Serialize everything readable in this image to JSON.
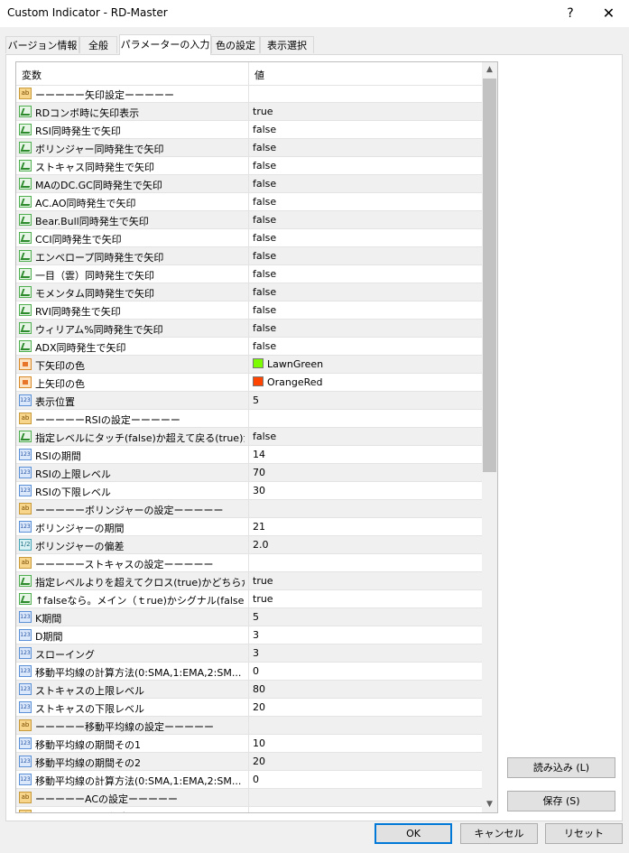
{
  "window": {
    "title": "Custom Indicator - RD-Master",
    "help": "?",
    "close": "✕"
  },
  "tabs": [
    "バージョン情報",
    "全般",
    "パラメーターの入力",
    "色の設定",
    "表示選択"
  ],
  "grid": {
    "header_name": "変数",
    "header_value": "値",
    "rows": [
      {
        "type": "ab",
        "name": "ーーーーー矢印設定ーーーーー",
        "value": ""
      },
      {
        "type": "bool",
        "name": "RDコンボ時に矢印表示",
        "value": "true"
      },
      {
        "type": "bool",
        "name": "RSI同時発生で矢印",
        "value": "false"
      },
      {
        "type": "bool",
        "name": "ボリンジャー同時発生で矢印",
        "value": "false"
      },
      {
        "type": "bool",
        "name": "ストキャス同時発生で矢印",
        "value": "false"
      },
      {
        "type": "bool",
        "name": "MAのDC.GC同時発生で矢印",
        "value": "false"
      },
      {
        "type": "bool",
        "name": "AC.AO同時発生で矢印",
        "value": "false"
      },
      {
        "type": "bool",
        "name": "Bear.Bull同時発生で矢印",
        "value": "false"
      },
      {
        "type": "bool",
        "name": "CCI同時発生で矢印",
        "value": "false"
      },
      {
        "type": "bool",
        "name": "エンベロープ同時発生で矢印",
        "value": "false"
      },
      {
        "type": "bool",
        "name": "一目（雲）同時発生で矢印",
        "value": "false"
      },
      {
        "type": "bool",
        "name": "モメンタム同時発生で矢印",
        "value": "false"
      },
      {
        "type": "bool",
        "name": "RVI同時発生で矢印",
        "value": "false"
      },
      {
        "type": "bool",
        "name": "ウィリアム%同時発生で矢印",
        "value": "false"
      },
      {
        "type": "bool",
        "name": "ADX同時発生で矢印",
        "value": "false"
      },
      {
        "type": "color",
        "name": "下矢印の色",
        "value": "LawnGreen",
        "swatch": "#7cfc00"
      },
      {
        "type": "color",
        "name": "上矢印の色",
        "value": "OrangeRed",
        "swatch": "#ff4500"
      },
      {
        "type": "int",
        "name": "表示位置",
        "value": "5"
      },
      {
        "type": "ab",
        "name": "ーーーーーRSIの設定ーーーーー",
        "value": ""
      },
      {
        "type": "bool",
        "name": "指定レベルにタッチ(false)か超えて戻る(true)か",
        "value": "false"
      },
      {
        "type": "int",
        "name": "RSIの期間",
        "value": "14"
      },
      {
        "type": "int",
        "name": "RSIの上限レベル",
        "value": "70"
      },
      {
        "type": "int",
        "name": "RSIの下限レベル",
        "value": "30"
      },
      {
        "type": "ab",
        "name": "ーーーーーボリンジャーの設定ーーーーー",
        "value": ""
      },
      {
        "type": "int",
        "name": "ボリンジャーの期間",
        "value": "21"
      },
      {
        "type": "dbl",
        "name": "ボリンジャーの偏差",
        "value": "2.0"
      },
      {
        "type": "ab",
        "name": "ーーーーーストキャスの設定ーーーーー",
        "value": ""
      },
      {
        "type": "bool",
        "name": "指定レベルよりを超えてクロス(true)かどちらかの...",
        "value": "true"
      },
      {
        "type": "bool",
        "name": "↑falseなら。メイン（ｔrue)かシグナル(false)か",
        "value": "true"
      },
      {
        "type": "int",
        "name": "K期間",
        "value": "5"
      },
      {
        "type": "int",
        "name": "D期間",
        "value": "3"
      },
      {
        "type": "int",
        "name": "スローイング",
        "value": "3"
      },
      {
        "type": "int",
        "name": "移動平均線の計算方法(0:SMA,1:EMA,2:SM...",
        "value": "0"
      },
      {
        "type": "int",
        "name": "ストキャスの上限レベル",
        "value": "80"
      },
      {
        "type": "int",
        "name": "ストキャスの下限レベル",
        "value": "20"
      },
      {
        "type": "ab",
        "name": "ーーーーー移動平均線の設定ーーーーー",
        "value": ""
      },
      {
        "type": "int",
        "name": "移動平均線の期間その1",
        "value": "10"
      },
      {
        "type": "int",
        "name": "移動平均線の期間その2",
        "value": "20"
      },
      {
        "type": "int",
        "name": "移動平均線の計算方法(0:SMA,1:EMA,2:SM...",
        "value": "0"
      },
      {
        "type": "ab",
        "name": "ーーーーーACの設定ーーーーー",
        "value": ""
      },
      {
        "type": "ab",
        "name": "ーーーーーAOの設定ーーーーー",
        "value": ""
      }
    ]
  },
  "side_buttons": {
    "load": "読み込み (L)",
    "save": "保存 (S)"
  },
  "footer_buttons": {
    "ok": "OK",
    "cancel": "キャンセル",
    "reset": "リセット"
  },
  "icon_labels": {
    "ab": "ab",
    "int": "123",
    "dbl": "1/2"
  }
}
